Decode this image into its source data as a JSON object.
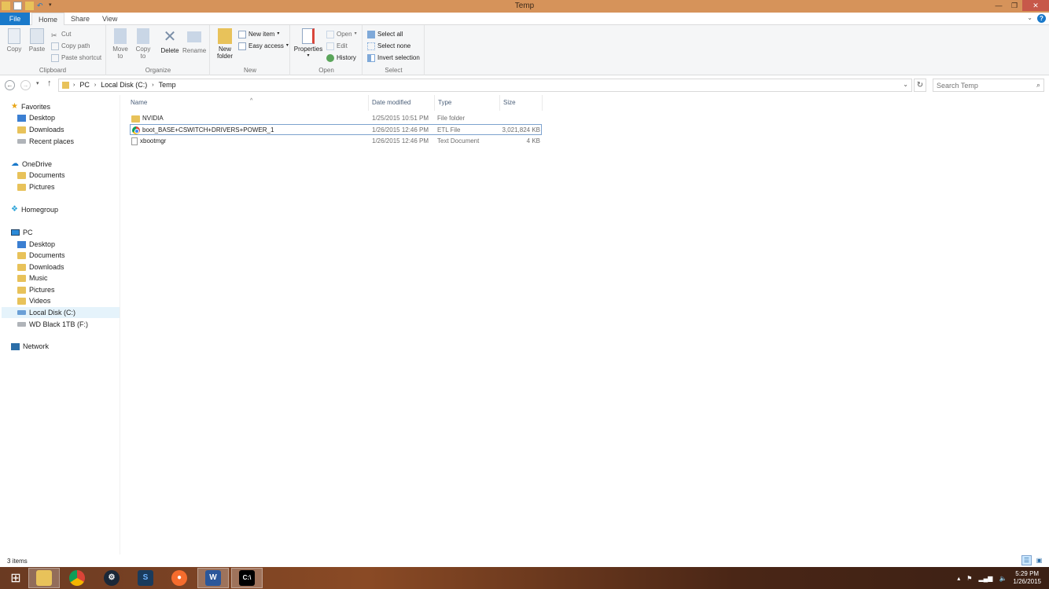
{
  "window": {
    "title": "Temp"
  },
  "ribbon_tabs": {
    "file": "File",
    "home": "Home",
    "share": "Share",
    "view": "View"
  },
  "ribbon": {
    "clipboard": {
      "label": "Clipboard",
      "copy": "Copy",
      "paste": "Paste",
      "cut": "Cut",
      "copy_path": "Copy path",
      "paste_shortcut": "Paste shortcut"
    },
    "organize": {
      "label": "Organize",
      "move_to": "Move",
      "move_to2": "to",
      "copy_to": "Copy",
      "copy_to2": "to",
      "delete": "Delete",
      "rename": "Rename"
    },
    "new": {
      "label": "New",
      "new_folder": "New",
      "new_folder2": "folder",
      "new_item": "New item",
      "easy_access": "Easy access"
    },
    "open": {
      "label": "Open",
      "properties": "Properties",
      "open": "Open",
      "edit": "Edit",
      "history": "History"
    },
    "select": {
      "label": "Select",
      "select_all": "Select all",
      "select_none": "Select none",
      "invert": "Invert selection"
    }
  },
  "address": {
    "crumbs": [
      "PC",
      "Local Disk (C:)",
      "Temp"
    ],
    "search_placeholder": "Search Temp"
  },
  "nav": {
    "favorites": "Favorites",
    "fav_items": [
      "Desktop",
      "Downloads",
      "Recent places"
    ],
    "onedrive": "OneDrive",
    "onedrive_items": [
      "Documents",
      "Pictures"
    ],
    "homegroup": "Homegroup",
    "pc": "PC",
    "pc_items": [
      "Desktop",
      "Documents",
      "Downloads",
      "Music",
      "Pictures",
      "Videos",
      "Local Disk (C:)",
      "WD Black 1TB (F:)"
    ],
    "network": "Network"
  },
  "columns": {
    "name": "Name",
    "date": "Date modified",
    "type": "Type",
    "size": "Size"
  },
  "files": [
    {
      "name": "NVIDIA",
      "date": "1/25/2015 10:51 PM",
      "type": "File folder",
      "size": ""
    },
    {
      "name": "boot_BASE+CSWITCH+DRIVERS+POWER_1",
      "date": "1/26/2015 12:46 PM",
      "type": "ETL File",
      "size": "3,021,824 KB"
    },
    {
      "name": "xbootmgr",
      "date": "1/26/2015 12:46 PM",
      "type": "Text Document",
      "size": "4 KB"
    }
  ],
  "status": {
    "items": "3 items"
  },
  "taskbar": {
    "time": "5:29 PM",
    "date": "1/26/2015"
  },
  "colors": {
    "titlebar": "#d6935a",
    "file_tab": "#1979ca",
    "selection": "#e5f3fb"
  }
}
